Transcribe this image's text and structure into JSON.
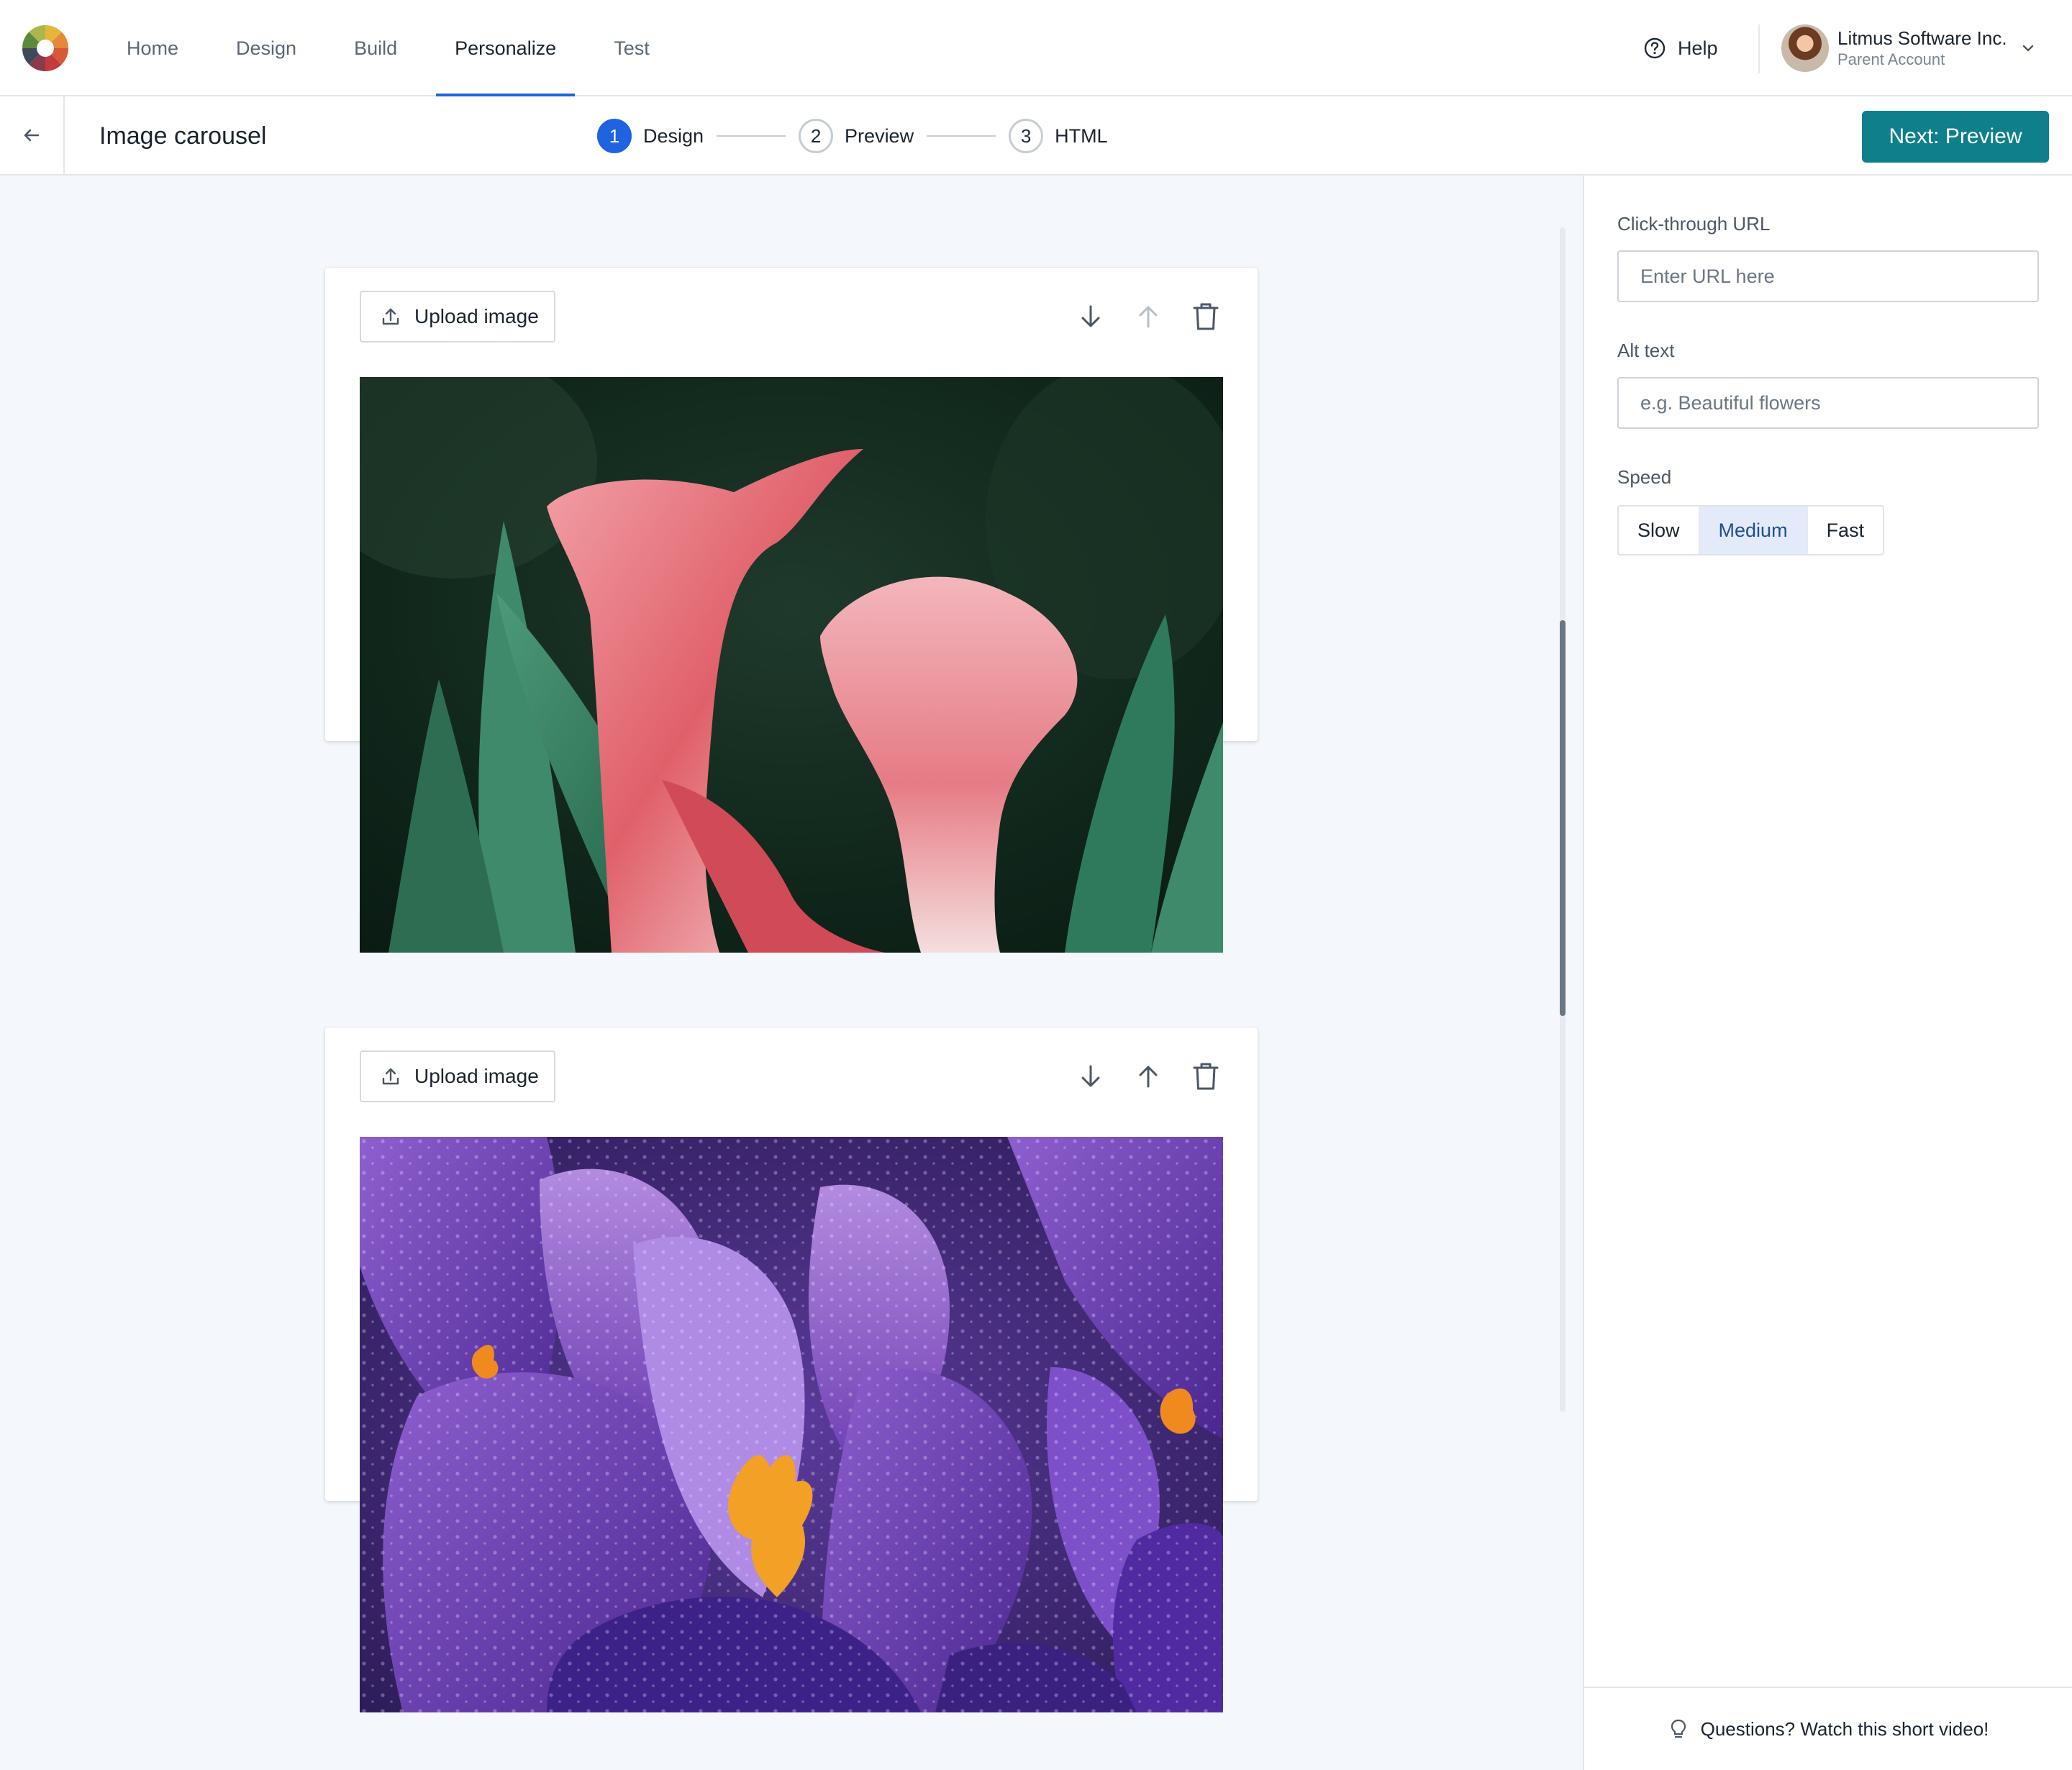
{
  "nav": {
    "items": [
      {
        "label": "Home",
        "active": false
      },
      {
        "label": "Design",
        "active": false
      },
      {
        "label": "Build",
        "active": false
      },
      {
        "label": "Personalize",
        "active": true
      },
      {
        "label": "Test",
        "active": false
      }
    ],
    "help_label": "Help",
    "account_name": "Litmus Software Inc.",
    "account_type": "Parent Account"
  },
  "header": {
    "title": "Image carousel",
    "steps": [
      {
        "number": "1",
        "label": "Design",
        "active": true
      },
      {
        "number": "2",
        "label": "Preview",
        "active": false
      },
      {
        "number": "3",
        "label": "HTML",
        "active": false
      }
    ],
    "next_label": "Next: Preview"
  },
  "cards": [
    {
      "upload_label": "Upload image",
      "image": "pink-calla-lilies",
      "move_up_enabled": false
    },
    {
      "upload_label": "Upload image",
      "image": "purple-crocus-with-dew",
      "move_up_enabled": true
    }
  ],
  "settings": {
    "url_label": "Click-through URL",
    "url_placeholder": "Enter URL here",
    "url_value": "",
    "alt_label": "Alt text",
    "alt_placeholder": "e.g. Beautiful flowers",
    "alt_value": "",
    "speed_label": "Speed",
    "speed_options": [
      "Slow",
      "Medium",
      "Fast"
    ],
    "speed_selected": "Medium"
  },
  "footer": {
    "video_prompt": "Questions? Watch this short video!"
  },
  "colors": {
    "primary_blue": "#1f63e0",
    "teal_button": "#0f7f8c",
    "canvas_bg": "#f4f7fb",
    "segment_active_bg": "#e3ebfb"
  },
  "icons": [
    "litmus-logo-icon",
    "help-circle-icon",
    "chevron-down-icon",
    "arrow-left-icon",
    "upload-icon",
    "arrow-down-icon",
    "arrow-up-icon",
    "trash-icon",
    "lightbulb-icon"
  ]
}
